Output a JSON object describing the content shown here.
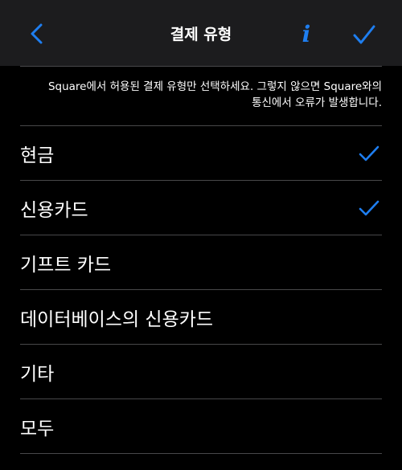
{
  "nav": {
    "title": "결제 유형",
    "info_glyph": "i",
    "back_icon": "chevron-left-icon",
    "done_icon": "checkmark-icon"
  },
  "notice": {
    "line1": "Square에서 허용된 결제 유형만 선택하세요. 그렇지 않으면 Square와의",
    "line2": "통신에서 오류가 발생합니다."
  },
  "options": [
    {
      "label": "현금",
      "selected": true
    },
    {
      "label": "신용카드",
      "selected": true
    },
    {
      "label": "기프트 카드",
      "selected": false
    },
    {
      "label": "데이터베이스의 신용카드",
      "selected": false
    },
    {
      "label": "기타",
      "selected": false
    },
    {
      "label": "모두",
      "selected": false
    }
  ],
  "colors": {
    "accent": "#1e7ef0",
    "nav_background": "#1c1c1e",
    "background": "#000000",
    "separator": "#48484a"
  }
}
